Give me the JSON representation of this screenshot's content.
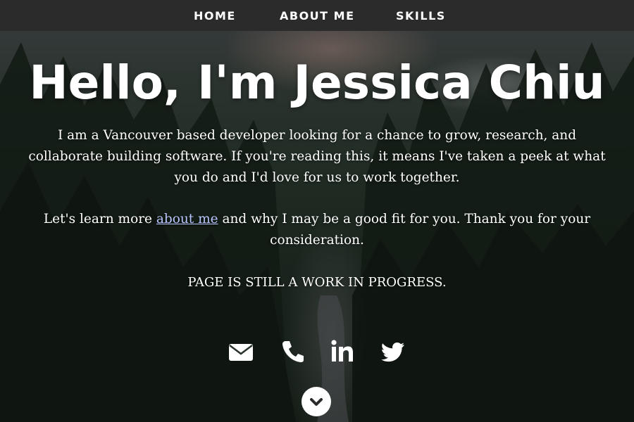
{
  "nav": {
    "items": [
      {
        "label": "HOME"
      },
      {
        "label": "ABOUT ME"
      },
      {
        "label": "SKILLS"
      }
    ]
  },
  "hero": {
    "title": "Hello, I'm Jessica Chiu",
    "intro": "I am a Vancouver based developer looking for a chance to grow, research, and collaborate building software. If you're reading this, it means I've taken a peek at what you do and I'd love for us to work together.",
    "learn_before": "Let's learn more ",
    "learn_link": "about me",
    "learn_after": " and why I may be a good fit for you. Thank you for your consideration.",
    "wip": "PAGE IS STILL A WORK IN PROGRESS."
  },
  "social": {
    "icons": [
      "envelope-icon",
      "phone-icon",
      "linkedin-icon",
      "twitter-icon"
    ]
  },
  "scroll": {
    "icon": "chevron-down-icon"
  },
  "colors": {
    "navbar": "#2b2b2b",
    "text": "#ffffff",
    "link": "#b9c6ff"
  }
}
